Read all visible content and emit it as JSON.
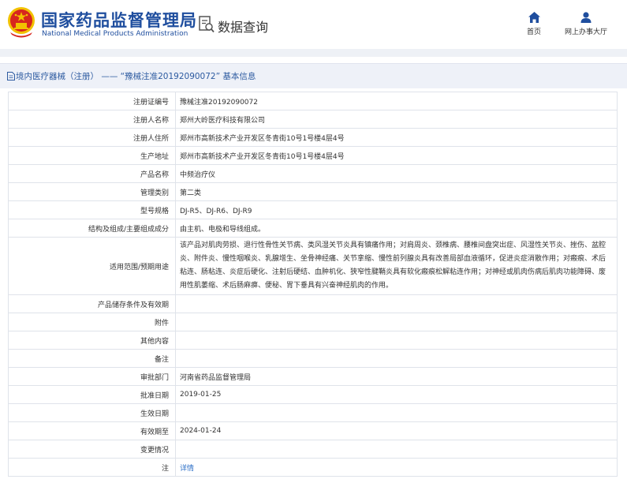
{
  "header": {
    "org_name_cn": "国家药品监督管理局",
    "org_name_en": "National Medical Products Administration",
    "section_title": "数据查询",
    "nav": [
      {
        "label": "首页",
        "icon": "home-icon"
      },
      {
        "label": "网上办事大厅",
        "icon": "user-icon"
      }
    ]
  },
  "breadcrumb": {
    "text": "境内医疗器械（注册） —— “豫械注准20192090072” 基本信息"
  },
  "record": {
    "rows": [
      {
        "label": "注册证编号",
        "value": "豫械注准20192090072"
      },
      {
        "label": "注册人名称",
        "value": "郑州大岭医疗科技有限公司"
      },
      {
        "label": "注册人住所",
        "value": "郑州市高新技术产业开发区冬青街10号1号楼4层4号"
      },
      {
        "label": "生产地址",
        "value": "郑州市高新技术产业开发区冬青街10号1号楼4层4号"
      },
      {
        "label": "产品名称",
        "value": "中频治疗仪"
      },
      {
        "label": "管理类别",
        "value": "第二类"
      },
      {
        "label": "型号规格",
        "value": "DJ-R5、DJ-R6、DJ-R9"
      },
      {
        "label": "结构及组成/主要组成成分",
        "value": "由主机、电极和导线组成。"
      },
      {
        "label": "适用范围/预期用途",
        "value": "该产品对肌肉劳损、退行性骨性关节病、类风湿关节炎具有镇痛作用；对肩周炎、颈椎病、腰椎间盘突出症、风湿性关节炎、挫伤、盆腔炎、附件炎、慢性咽喉炎、乳腺增生、坐骨神经痛、关节挛缩、慢性前列腺炎具有改善局部血液循环，促进炎症消散作用；对瘢痕、术后粘连、肠粘连、炎症后硬化、注射后硬结、血肿机化、狭窄性腱鞘炎具有软化瘢痕松解粘连作用；对神经或肌肉伤病后肌肉功能障碍、废用性肌萎缩、术后肠麻痹、便秘、胃下垂具有兴奋神经肌肉的作用。"
      },
      {
        "label": "产品储存条件及有效期",
        "value": ""
      },
      {
        "label": "附件",
        "value": ""
      },
      {
        "label": "其他内容",
        "value": ""
      },
      {
        "label": "备注",
        "value": ""
      },
      {
        "label": "审批部门",
        "value": "河南省药品监督管理局"
      },
      {
        "label": "批准日期",
        "value": "2019-01-25"
      },
      {
        "label": "生效日期",
        "value": ""
      },
      {
        "label": "有效期至",
        "value": "2024-01-24"
      },
      {
        "label": "变更情况",
        "value": ""
      },
      {
        "label": "注",
        "value": "详情"
      }
    ]
  },
  "colors": {
    "brand_blue": "#1f4e9e",
    "link_blue": "#2c6fc7",
    "emblem_red": "#d7261e",
    "emblem_gold": "#f2c200"
  }
}
